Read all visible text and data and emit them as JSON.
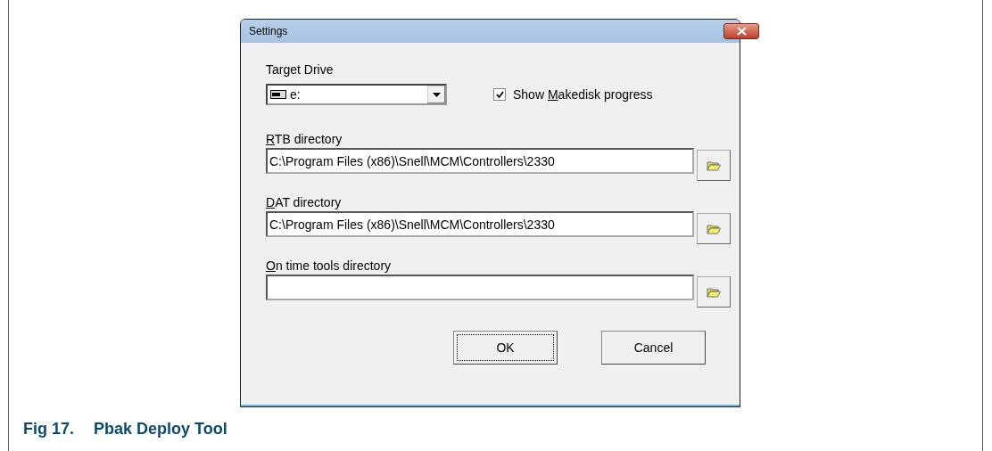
{
  "dialog": {
    "title": "Settings",
    "target_drive": {
      "label": "Target Drive",
      "value": "e:"
    },
    "show_progress": {
      "before": "Show ",
      "mnemonic": "M",
      "after": "akedisk progress",
      "checked": true
    },
    "directories": [
      {
        "mnemonic": "R",
        "rest": "TB directory",
        "value": "C:\\Program Files (x86)\\Snell\\MCM\\Controllers\\2330"
      },
      {
        "mnemonic": "D",
        "rest": "AT directory",
        "value": "C:\\Program Files (x86)\\Snell\\MCM\\Controllers\\2330"
      },
      {
        "mnemonic": "O",
        "rest": "n time tools directory"
      }
    ],
    "buttons": [
      {
        "label": "OK",
        "focused": true
      },
      {
        "label": "Cancel",
        "focused": false
      }
    ]
  },
  "caption": {
    "number": "Fig 17.",
    "text": "Pbak Deploy Tool"
  }
}
